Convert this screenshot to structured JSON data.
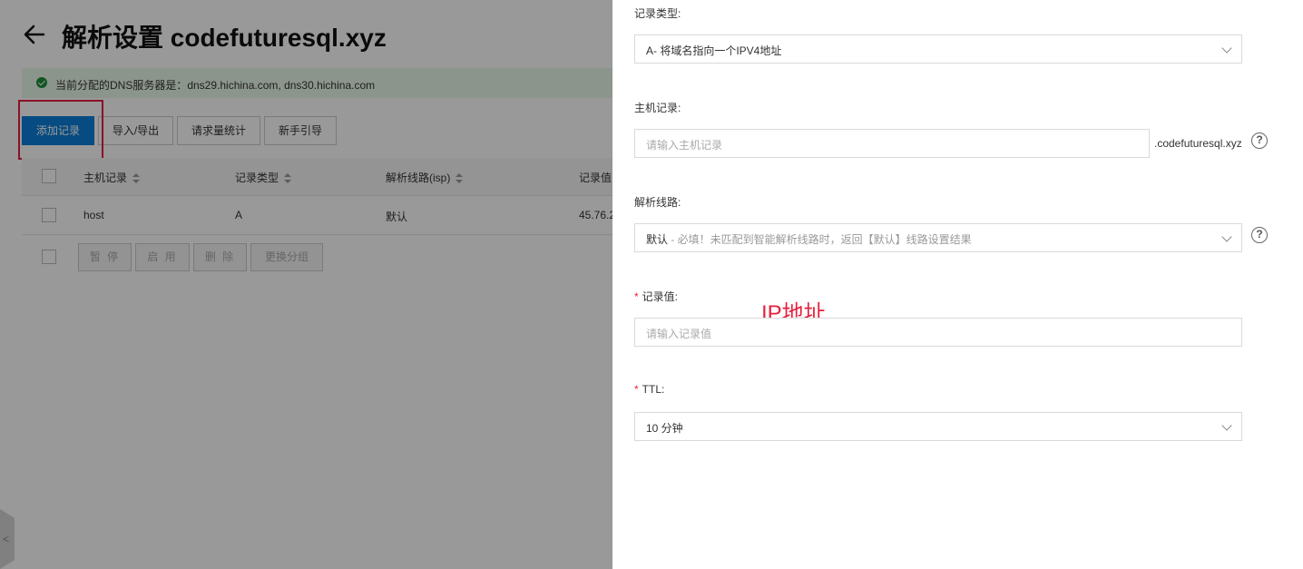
{
  "page": {
    "title": "解析设置 codefuturesql.xyz",
    "dns_banner": "当前分配的DNS服务器是：dns29.hichina.com, dns30.hichina.com",
    "toolbar": {
      "add_record": "添加记录",
      "import_export": "导入/导出",
      "request_stats": "请求量统计",
      "beginner_guide": "新手引导"
    },
    "table": {
      "headers": {
        "host": "主机记录",
        "type": "记录类型",
        "line": "解析线路(isp)",
        "value": "记录值"
      },
      "rows": [
        {
          "host": "host",
          "type": "A",
          "line": "默认",
          "value": "45.76.2"
        }
      ]
    },
    "batch": {
      "pause": "暂 停",
      "enable": "启 用",
      "delete": "删 除",
      "change_group": "更换分组"
    },
    "side_tab": "<"
  },
  "panel": {
    "record_type": {
      "label": "记录类型:",
      "value": "A- 将域名指向一个IPV4地址"
    },
    "host_record": {
      "label": "主机记录:",
      "placeholder": "请输入主机记录",
      "suffix": ".codefuturesql.xyz"
    },
    "resolve_line": {
      "label": "解析线路:",
      "value_main": "默认",
      "value_hint": " - 必填！未匹配到智能解析线路时，返回【默认】线路设置结果"
    },
    "record_value": {
      "required": "*",
      "label": "记录值:",
      "placeholder": "请输入记录值",
      "annotation": "IP地址"
    },
    "ttl": {
      "required": "*",
      "label": "TTL:",
      "value": "10 分钟"
    },
    "help_glyph": "?"
  },
  "colors": {
    "primary": "#0b7ed8",
    "highlight": "#e6213e",
    "success": "#1e8e3e",
    "banner_bg": "#eaf8ea"
  }
}
